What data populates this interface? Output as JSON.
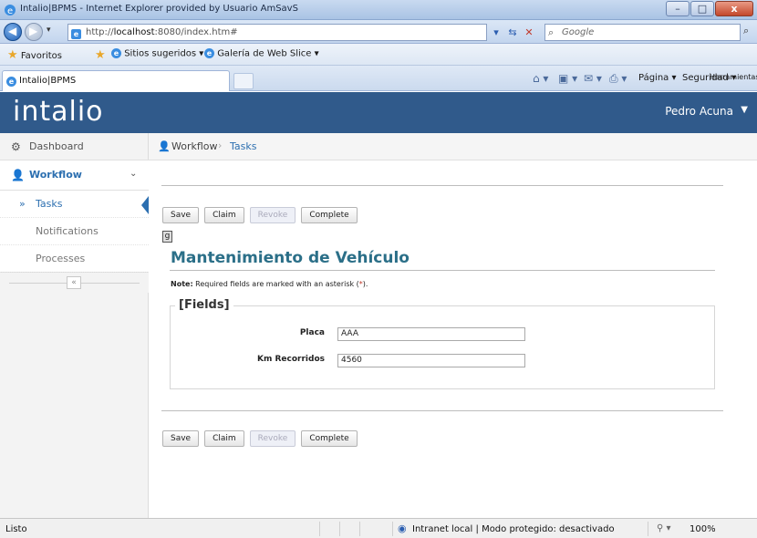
{
  "window": {
    "title": "Intalio|BPMS - Internet Explorer provided by Usuario AmSavS",
    "controls": {
      "minimize": "–",
      "maximize": "□",
      "close": "x"
    }
  },
  "browser": {
    "address_host_prefix": "http://",
    "address_host": "localhost",
    "address_rest": ":8080/index.htm#",
    "search_placeholder": "Google",
    "favorites_label": "Favoritos",
    "suggested_sites": "Sitios sugeridos ▾",
    "web_slice_gallery": "Galería de Web Slice ▾",
    "tab_label": "Intalio|BPMS",
    "commands": {
      "page": "Página ▾",
      "security": "Seguridad ▾",
      "tools": "Herramientas ▾"
    },
    "status_text": "Listo",
    "zone_text": "Intranet local | Modo protegido: desactivado",
    "zoom_text": "100%"
  },
  "app": {
    "logo": "intalio",
    "user_name": "Pedro Acuna",
    "accent": "#2c6fb0",
    "header_color": "#305a8b"
  },
  "sidebar": {
    "dashboard": "Dashboard",
    "workflow": "Workflow",
    "items": [
      {
        "label": "Tasks",
        "active": true
      },
      {
        "label": "Notifications",
        "active": false
      },
      {
        "label": "Processes",
        "active": false
      }
    ],
    "collapse_label": "«"
  },
  "breadcrumb": {
    "root": "Workflow",
    "separator": "›",
    "current": "Tasks"
  },
  "form": {
    "buttons": {
      "save": "Save",
      "claim": "Claim",
      "revoke": "Revoke",
      "complete": "Complete"
    },
    "icon_glyph": "g",
    "title": "Mantenimiento de Vehículo",
    "note_prefix": "Note:",
    "note_body": " Required fields are marked with an asterisk (",
    "note_asterisk": "*",
    "note_suffix": ").",
    "section_legend": "[Fields]",
    "fields": [
      {
        "label": "Placa",
        "value": "AAA"
      },
      {
        "label": "Km Recorridos",
        "value": "4560"
      }
    ]
  }
}
